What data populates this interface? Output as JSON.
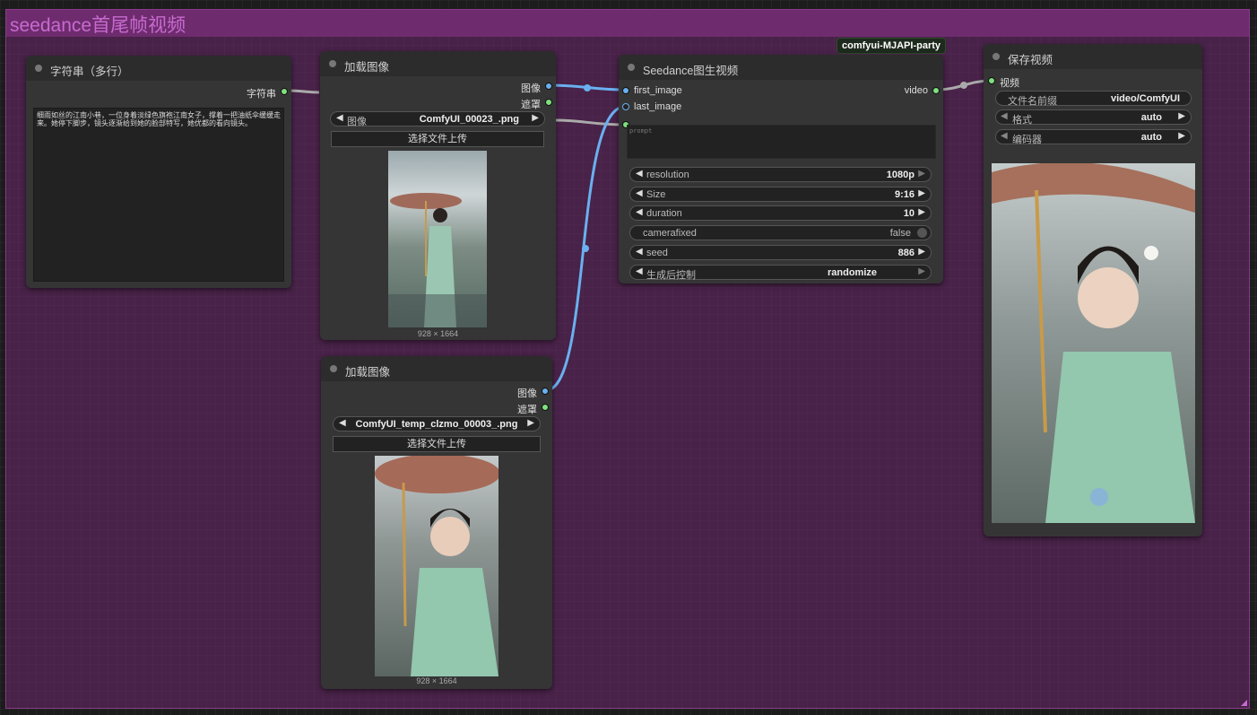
{
  "group": {
    "title": "seedance首尾帧视频"
  },
  "badge": "comfyui-MJAPI-party",
  "text_node": {
    "title": "字符串（多行）",
    "output_label": "字符串",
    "text": "细雨如丝的江南小巷，一位身着淡绿色旗袍江南女子，撑着一把油纸伞缓缓走来。她停下脚步，镜头逐渐给到她的脸部特写，她优都的看向镜头。"
  },
  "load_image_1": {
    "title": "加载图像",
    "out_image": "图像",
    "out_mask": "遮罩",
    "widget_label": "图像",
    "file": "ComfyUI_00023_.png",
    "upload": "选择文件上传",
    "dims": "928 × 1664"
  },
  "load_image_2": {
    "title": "加载图像",
    "out_image": "图像",
    "out_mask": "遮罩",
    "file": "ComfyUI_temp_clzmo_00003_.png",
    "upload": "选择文件上传",
    "dims": "928 × 1664"
  },
  "seedance": {
    "title": "Seedance图生视频",
    "in_first": "first_image",
    "in_last": "last_image",
    "out_video": "video",
    "prompt_placeholder": "prompt",
    "widgets": [
      {
        "label": "resolution",
        "value": "1080p"
      },
      {
        "label": "Size",
        "value": "9:16"
      },
      {
        "label": "duration",
        "value": "10"
      },
      {
        "label": "camerafixed",
        "value": "false"
      },
      {
        "label": "seed",
        "value": "886"
      },
      {
        "label": "生成后控制",
        "value": "randomize"
      }
    ]
  },
  "save_video": {
    "title": "保存视频",
    "in_video": "视频",
    "widgets": [
      {
        "label": "文件名前缀",
        "value": "video/ComfyUI"
      },
      {
        "label": "格式",
        "value": "auto"
      },
      {
        "label": "编码器",
        "value": "auto"
      }
    ]
  },
  "colors": {
    "group_bg": "#6e2c6e",
    "group_title": "#c86ad0",
    "link_blue": "#6ab0f0",
    "link_gray": "#aaaaaa"
  }
}
